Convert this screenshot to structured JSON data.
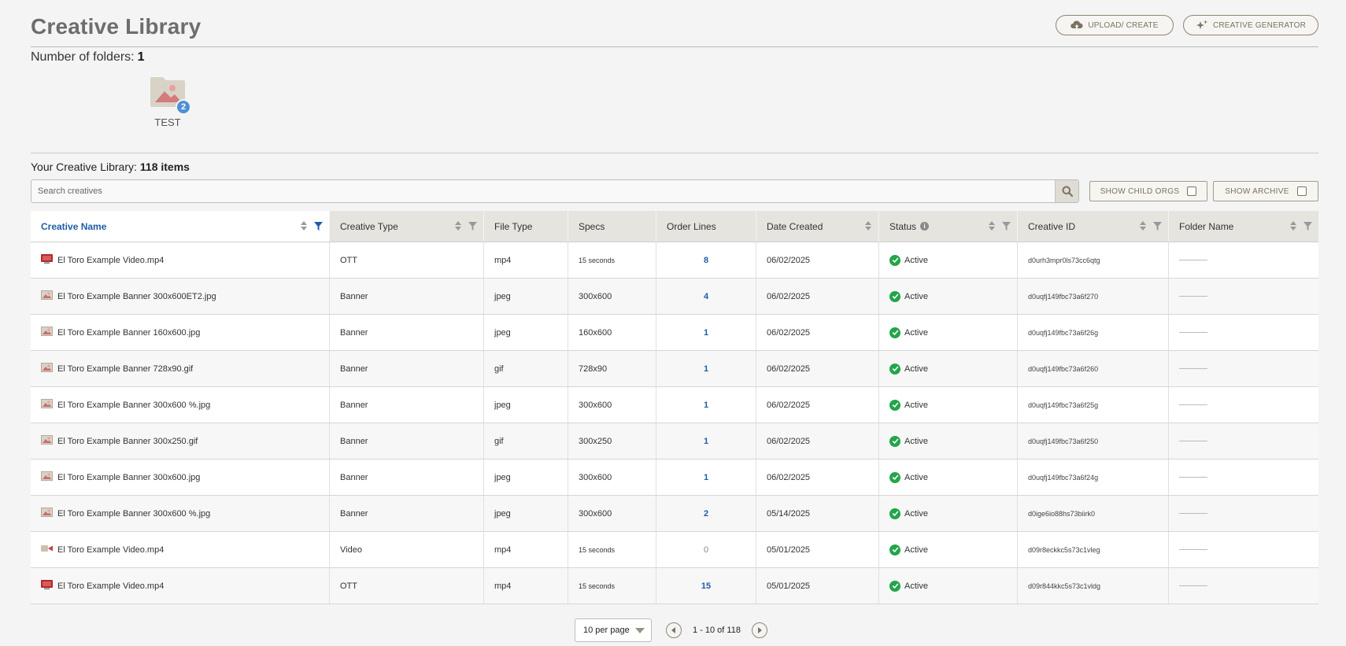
{
  "header": {
    "title": "Creative Library",
    "upload_label": "UPLOAD/ CREATE",
    "generator_label": "CREATIVE GENERATOR"
  },
  "folders": {
    "label": "Number of folders:",
    "count": "1",
    "items": [
      {
        "name": "TEST",
        "badge": "2"
      }
    ]
  },
  "library": {
    "label": "Your Creative Library:",
    "count": "118 items"
  },
  "search": {
    "placeholder": "Search creatives",
    "value": ""
  },
  "toggles": {
    "child_orgs": "SHOW CHILD ORGS",
    "archive": "SHOW ARCHIVE"
  },
  "table": {
    "columns": [
      "Creative Name",
      "Creative Type",
      "File Type",
      "Specs",
      "Order Lines",
      "Date Created",
      "Status",
      "Creative ID",
      "Folder Name"
    ],
    "rows": [
      {
        "icon": "tv-icon",
        "name": "El Toro Example Video.mp4",
        "type": "OTT",
        "file": "mp4",
        "specs": "15 seconds",
        "orders": "8",
        "date": "06/02/2025",
        "status": "Active",
        "id": "d0urh3mpr0ls73cc6qtg"
      },
      {
        "icon": "image-icon",
        "name": "El Toro Example Banner 300x600ET2.jpg",
        "type": "Banner",
        "file": "jpeg",
        "specs": "300x600",
        "orders": "4",
        "date": "06/02/2025",
        "status": "Active",
        "id": "d0uqfj149fbc73a6f270"
      },
      {
        "icon": "image-icon",
        "name": "El Toro Example Banner 160x600.jpg",
        "type": "Banner",
        "file": "jpeg",
        "specs": "160x600",
        "orders": "1",
        "date": "06/02/2025",
        "status": "Active",
        "id": "d0uqfj149fbc73a6f26g"
      },
      {
        "icon": "image-icon",
        "name": "El Toro Example Banner 728x90.gif",
        "type": "Banner",
        "file": "gif",
        "specs": "728x90",
        "orders": "1",
        "date": "06/02/2025",
        "status": "Active",
        "id": "d0uqfj149fbc73a6f260"
      },
      {
        "icon": "image-icon",
        "name": "El Toro Example Banner 300x600 %.jpg",
        "type": "Banner",
        "file": "jpeg",
        "specs": "300x600",
        "orders": "1",
        "date": "06/02/2025",
        "status": "Active",
        "id": "d0uqfj149fbc73a6f25g"
      },
      {
        "icon": "image-icon",
        "name": "El Toro Example Banner 300x250.gif",
        "type": "Banner",
        "file": "gif",
        "specs": "300x250",
        "orders": "1",
        "date": "06/02/2025",
        "status": "Active",
        "id": "d0uqfj149fbc73a6f250"
      },
      {
        "icon": "image-icon",
        "name": "El Toro Example Banner 300x600.jpg",
        "type": "Banner",
        "file": "jpeg",
        "specs": "300x600",
        "orders": "1",
        "date": "06/02/2025",
        "status": "Active",
        "id": "d0uqfj149fbc73a6f24g"
      },
      {
        "icon": "image-icon",
        "name": "El Toro Example Banner 300x600 %.jpg",
        "type": "Banner",
        "file": "jpeg",
        "specs": "300x600",
        "orders": "2",
        "date": "05/14/2025",
        "status": "Active",
        "id": "d0ige6io88hs73biirk0"
      },
      {
        "icon": "video-icon",
        "name": "El Toro Example Video.mp4",
        "type": "Video",
        "file": "mp4",
        "specs": "15 seconds",
        "orders": "0",
        "date": "05/01/2025",
        "status": "Active",
        "id": "d09r8eckkc5s73c1vleg"
      },
      {
        "icon": "tv-icon",
        "name": "El Toro Example Video.mp4",
        "type": "OTT",
        "file": "mp4",
        "specs": "15 seconds",
        "orders": "15",
        "date": "05/01/2025",
        "status": "Active",
        "id": "d09r844kkc5s73c1vldg"
      }
    ]
  },
  "pagination": {
    "per_page": "10 per page",
    "range": "1 - 10 of 118"
  },
  "colors": {
    "accent": "#1f5da8",
    "status_active": "#23a54a",
    "button_border": "#8f8672",
    "header_bg": "#e6e4de"
  }
}
